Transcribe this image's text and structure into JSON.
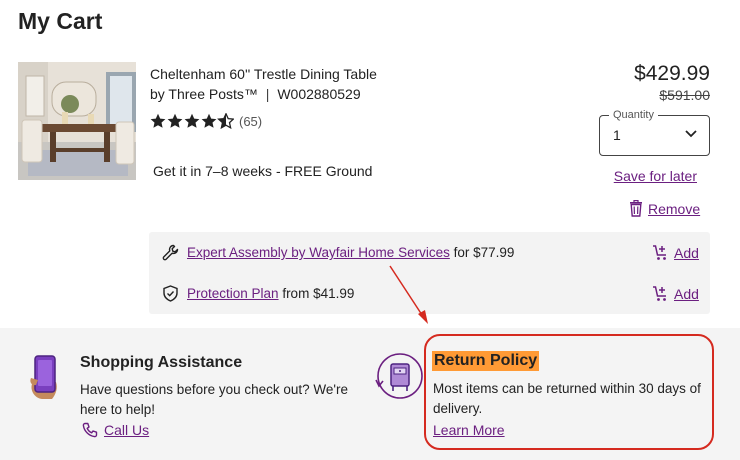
{
  "page": {
    "title": "My Cart"
  },
  "product": {
    "name": "Cheltenham 60'' Trestle Dining Table",
    "brand_line": "by Three Posts™",
    "sku": "W002880529",
    "rating": 4.5,
    "review_count": "(65)",
    "shipping": "Get it in 7–8 weeks - FREE Ground",
    "price": "$429.99",
    "original_price": "$591.00"
  },
  "quantity": {
    "label": "Quantity",
    "value": "1"
  },
  "actions": {
    "save_for_later": "Save for later",
    "remove": "Remove"
  },
  "services": [
    {
      "link": "Expert Assembly by Wayfair Home Services",
      "suffix": " for $77.99",
      "add_label": "Add",
      "icon": "wrench-icon"
    },
    {
      "link": "Protection Plan",
      "suffix": " from $41.99",
      "add_label": "Add",
      "icon": "shield-check-icon"
    }
  ],
  "shopping_assistance": {
    "title": "Shopping Assistance",
    "text": "Have questions before you check out? We're here to help!",
    "call_label": "Call Us"
  },
  "return_policy": {
    "title": "Return Policy",
    "text": "Most items can be returned within 30 days of delivery.",
    "link": "Learn More"
  },
  "colors": {
    "link": "#6b1f80",
    "highlight": "#ff9a35",
    "annotation_red": "#d52a1f",
    "footer_bg": "#f4f4f4"
  }
}
